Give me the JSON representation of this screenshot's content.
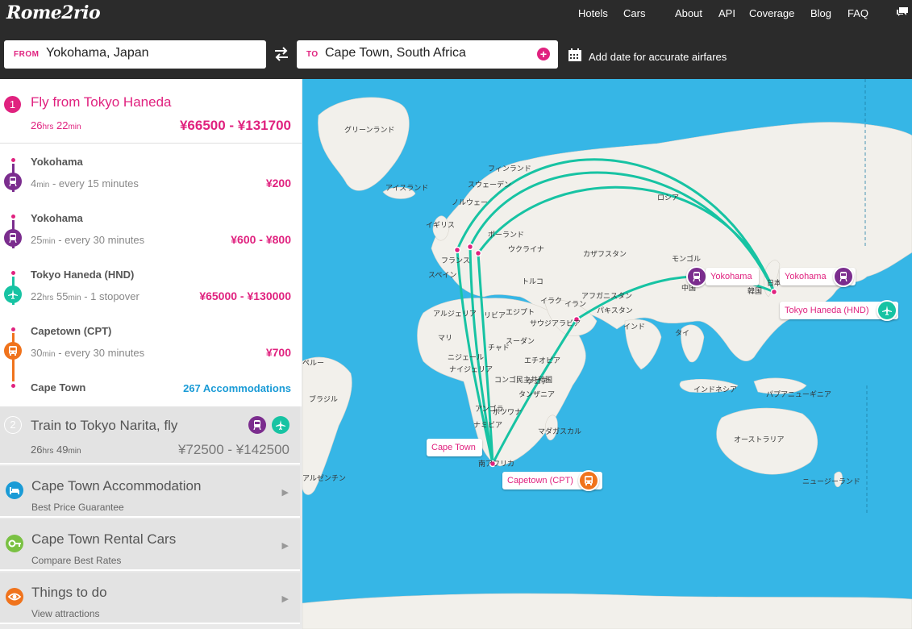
{
  "app": {
    "logo": "Rome2rio",
    "nav": [
      "Hotels",
      "Cars",
      "About",
      "API",
      "Coverage",
      "Blog",
      "FAQ"
    ]
  },
  "search": {
    "from_tag": "FROM",
    "from_value": "Yokohama, Japan",
    "to_tag": "TO",
    "to_value": "Cape Town, South Africa",
    "plus": "+",
    "date_label": "Add date for accurate airfares"
  },
  "route1": {
    "number": "1",
    "title": "Fly from Tokyo Haneda",
    "dur_h": "26",
    "dur_h_unit": "hrs",
    "dur_m": "22",
    "dur_m_unit": "min",
    "price": "¥66500 - ¥131700",
    "segments": [
      {
        "place": "Yokohama",
        "dur": "4",
        "dur_unit": "min",
        "info": " - every 15 minutes",
        "price": "¥200",
        "mode": "train",
        "color": "#7b2d8e"
      },
      {
        "place": "Yokohama",
        "dur": "25",
        "dur_unit": "min",
        "info": " - every 30 minutes",
        "price": "¥600 - ¥800",
        "mode": "train",
        "color": "#7b2d8e"
      },
      {
        "place": "Tokyo Haneda (HND)",
        "dur": "22",
        "dur_unit": "hrs",
        "dur2": "55",
        "dur2_unit": "min",
        "info": " - 1 stopover",
        "price": "¥65000 - ¥130000",
        "mode": "plane",
        "color": "#17c3a3"
      },
      {
        "place": "Capetown (CPT)",
        "dur": "30",
        "dur_unit": "min",
        "info": " - every 30 minutes",
        "price": "¥700",
        "mode": "bus",
        "color": "#f0731c"
      }
    ],
    "final_place": "Cape Town",
    "accommodations": "267 Accommodations"
  },
  "route2": {
    "number": "2",
    "title": "Train to Tokyo Narita, fly",
    "dur_h": "26",
    "dur_h_unit": "hrs",
    "dur_m": "49",
    "dur_m_unit": "min",
    "price": "¥72500 - ¥142500"
  },
  "cards": [
    {
      "title": "Cape Town Accommodation",
      "sub": "Best Price Guarantee",
      "icon": "bed-icon",
      "color": "#1a9bd6"
    },
    {
      "title": "Cape Town Rental Cars",
      "sub": "Compare Best Rates",
      "icon": "key-icon",
      "color": "#7ac143"
    },
    {
      "title": "Things to do",
      "sub": "View attractions",
      "icon": "eye-icon",
      "color": "#f0731c"
    }
  ],
  "map": {
    "labels": [
      "グリーンランド",
      "フィンランド",
      "スウェーデン",
      "アイスランド",
      "ノルウェー",
      "ロシア",
      "イギリス",
      "ポーランド",
      "ウクライナ",
      "カザフスタン",
      "モンゴル",
      "フランス",
      "スペイン",
      "トルコ",
      "中国",
      "日本",
      "韓国",
      "アフガニスタン",
      "パキスタン",
      "イラク",
      "イラン",
      "エジプト",
      "アルジェリア",
      "リビア",
      "サウジアラビア",
      "インド",
      "タイ",
      "マリ",
      "ニジェール",
      "チャド",
      "スーダン",
      "エチオピア",
      "ナイジェリア",
      "コンゴ民主共和国",
      "タンザニア",
      "ケニア",
      "アンゴラ",
      "ナミビア",
      "ボツワナ",
      "南アフリカ",
      "マダガスカル",
      "インドネシア",
      "パプアニューギニア",
      "オーストラリア",
      "ニュージーランド",
      "ブラジル",
      "アルゼンチン",
      "ペルー"
    ],
    "pins": [
      {
        "label": "Yokohama",
        "mode": "train"
      },
      {
        "label": "Yokohama",
        "mode": "train"
      },
      {
        "label": "Tokyo Haneda (HND)",
        "mode": "plane"
      },
      {
        "label": "Cape Town",
        "mode": "none"
      },
      {
        "label": "Capetown (CPT)",
        "mode": "bus"
      }
    ]
  },
  "colors": {
    "accent": "#e0227f",
    "route": "#17c3a3",
    "train": "#7b2d8e",
    "bus": "#f0731c",
    "ocean": "#36b6e6",
    "land": "#f2f0eb",
    "topbar": "#2b2b2b"
  }
}
